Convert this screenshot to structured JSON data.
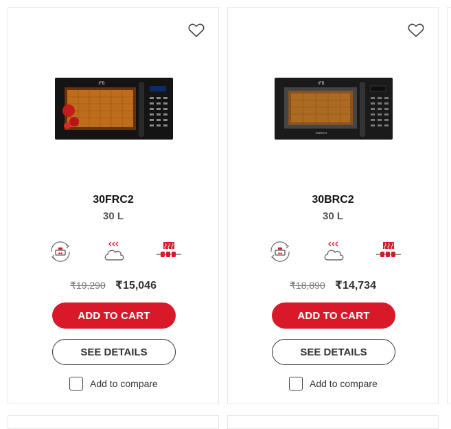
{
  "products": [
    {
      "model": "30FRC2",
      "capacity": "30 L",
      "mrp": "₹19,290",
      "price": "₹15,046",
      "add_to_cart": "ADD TO CART",
      "see_details": "SEE DETAILS",
      "compare_label": "Add to compare",
      "image_style": "floral",
      "image_brand": "IFB",
      "image_model": "30FRC2"
    },
    {
      "model": "30BRC2",
      "capacity": "30 L",
      "mrp": "₹18,890",
      "price": "₹14,734",
      "add_to_cart": "ADD TO CART",
      "see_details": "SEE DETAILS",
      "compare_label": "Add to compare",
      "image_style": "black",
      "image_brand": "IFB",
      "image_model": "30BRC2"
    }
  ],
  "feature_icons": [
    "rotisserie-icon",
    "steam-clean-icon",
    "grill-skewer-icon"
  ],
  "colors": {
    "accent": "#d7192a",
    "text": "#333333",
    "border": "#e6e6e6"
  }
}
